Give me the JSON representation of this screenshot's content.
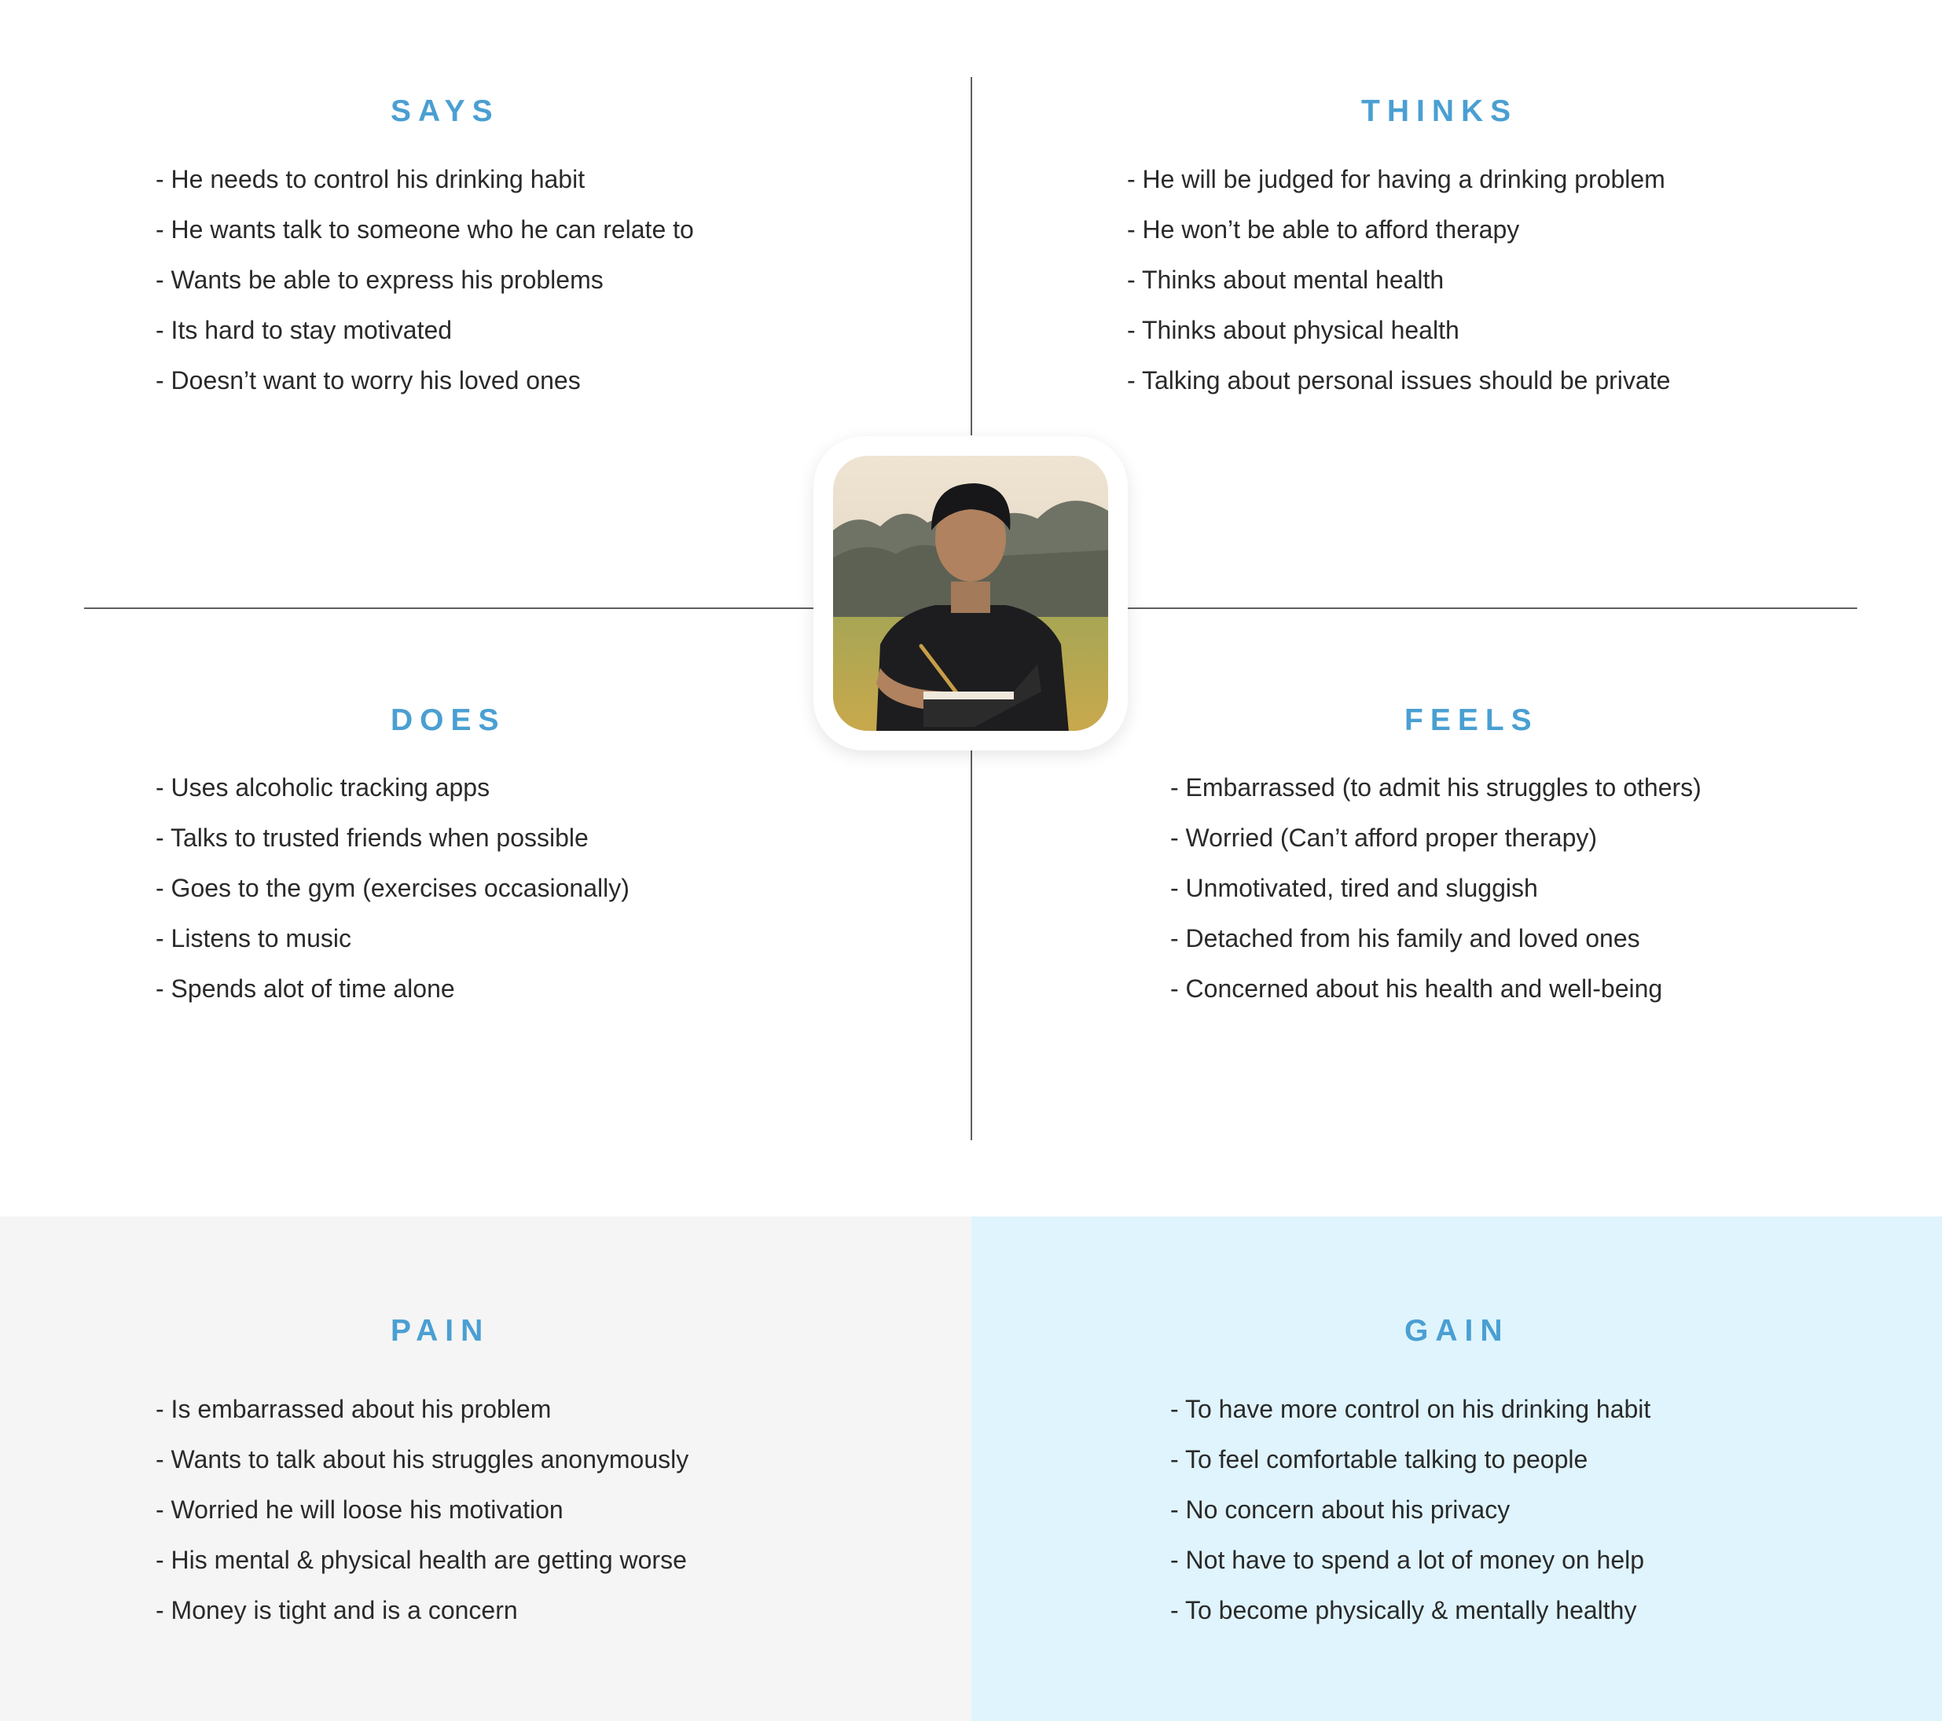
{
  "colors": {
    "title": "#4a9fd2",
    "pain_bg": "#f5f5f5",
    "gain_bg": "#dff4fd",
    "divider": "#5f5f5f"
  },
  "center_image": {
    "icon": "person-writing-in-notebook-photo"
  },
  "says": {
    "title": "SAYS",
    "items": [
      "- He needs to control his drinking habit",
      "- He wants talk to someone who he can relate to",
      "- Wants be able to express his problems",
      "- Its hard to stay motivated",
      "- Doesn’t want to worry his loved ones"
    ]
  },
  "thinks": {
    "title": "THINKS",
    "items": [
      "- He will be judged for having a drinking problem",
      "- He won’t be able to afford therapy",
      "- Thinks about mental health",
      "- Thinks about physical health",
      "- Talking about personal issues should be private"
    ]
  },
  "does": {
    "title": "DOES",
    "items": [
      "- Uses alcoholic tracking apps",
      "- Talks to trusted friends when possible",
      "- Goes to the gym (exercises occasionally)",
      "- Listens to music",
      "- Spends alot of time alone"
    ]
  },
  "feels": {
    "title": "FEELS",
    "items": [
      "- Embarrassed (to admit his struggles to others)",
      "- Worried (Can’t afford proper therapy)",
      "- Unmotivated, tired and sluggish",
      "- Detached from his family and loved ones",
      "- Concerned about his health and well-being"
    ]
  },
  "pain": {
    "title": "PAIN",
    "items": [
      "- Is embarrassed about his problem",
      "- Wants to talk about his struggles anonymously",
      "- Worried he will loose his motivation",
      "- His mental & physical health are getting worse",
      "- Money is tight and is a concern"
    ]
  },
  "gain": {
    "title": "GAIN",
    "items": [
      "- To have more control on his drinking habit",
      "- To feel comfortable talking to people",
      "- No concern about his privacy",
      "- Not have to spend a lot of money on help",
      "- To become physically & mentally healthy"
    ]
  }
}
